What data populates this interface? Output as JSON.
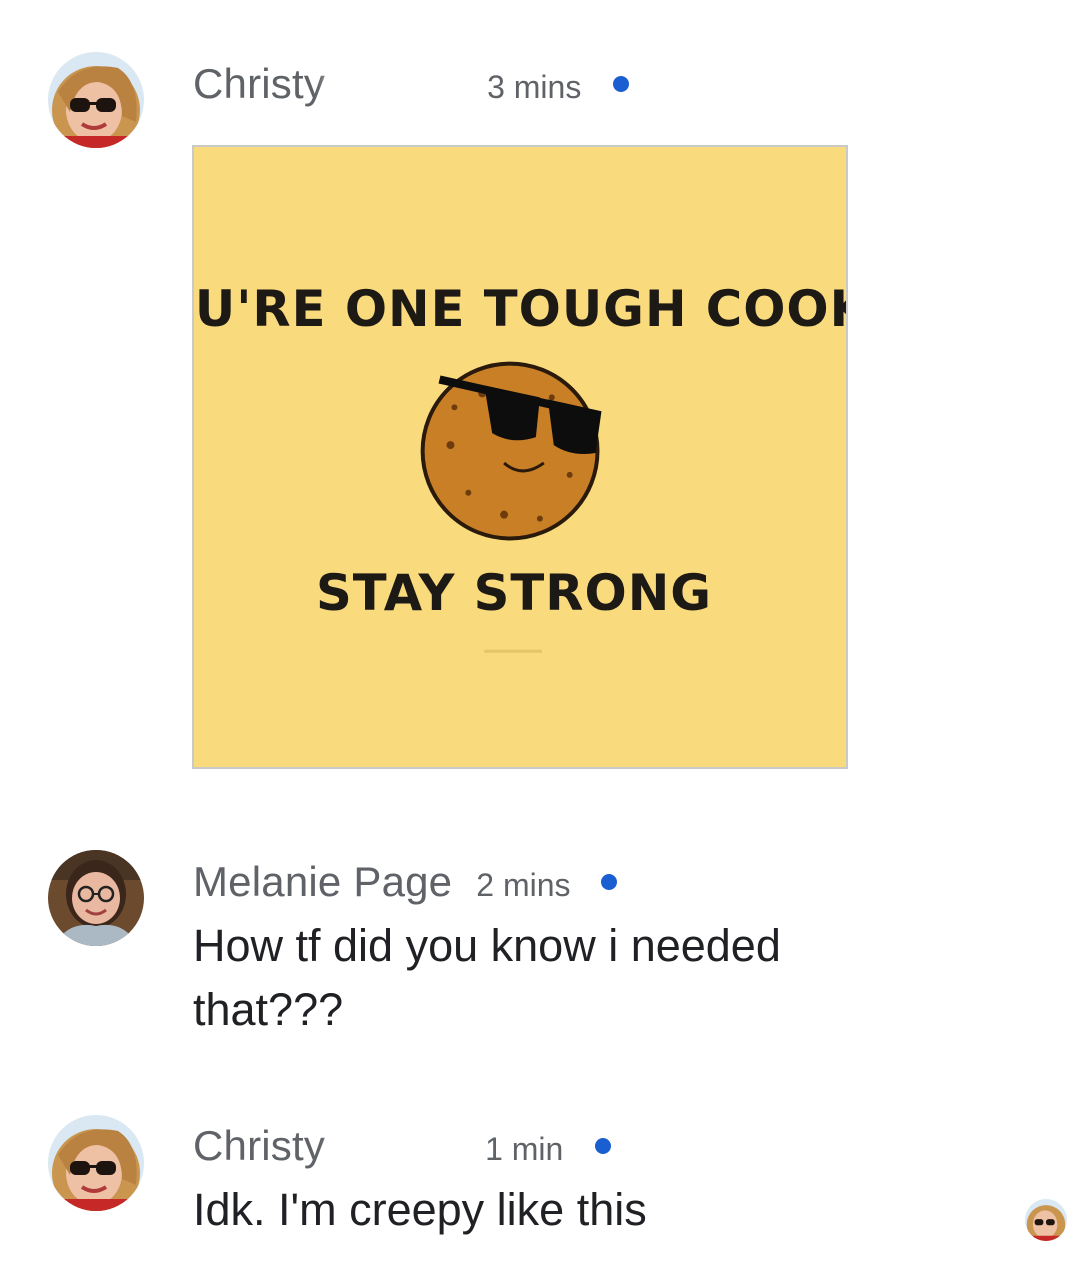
{
  "comments": [
    {
      "author": "Christy",
      "time": "3 mins",
      "avatar_icon": "avatar-woman-sunglasses",
      "unread": true,
      "sticker": {
        "line1": "YOU'RE ONE TOUGH COOKIE",
        "line2": "STAY STRONG",
        "icon": "cookie-sunglasses-icon",
        "background": "#f9da7d"
      }
    },
    {
      "author": "Melanie Page",
      "time": "2 mins",
      "avatar_icon": "avatar-woman-glasses-scarf",
      "unread": true,
      "text": "How tf did you know i needed that???"
    },
    {
      "author": "Christy",
      "time": "1 min",
      "avatar_icon": "avatar-woman-sunglasses",
      "unread": true,
      "text": "Idk. I'm creepy like this"
    }
  ],
  "seen_by_avatar": "avatar-woman-sunglasses",
  "colors": {
    "unread_dot": "#1a5fd1",
    "meta_text": "#5f6368",
    "body_text": "#202124"
  }
}
